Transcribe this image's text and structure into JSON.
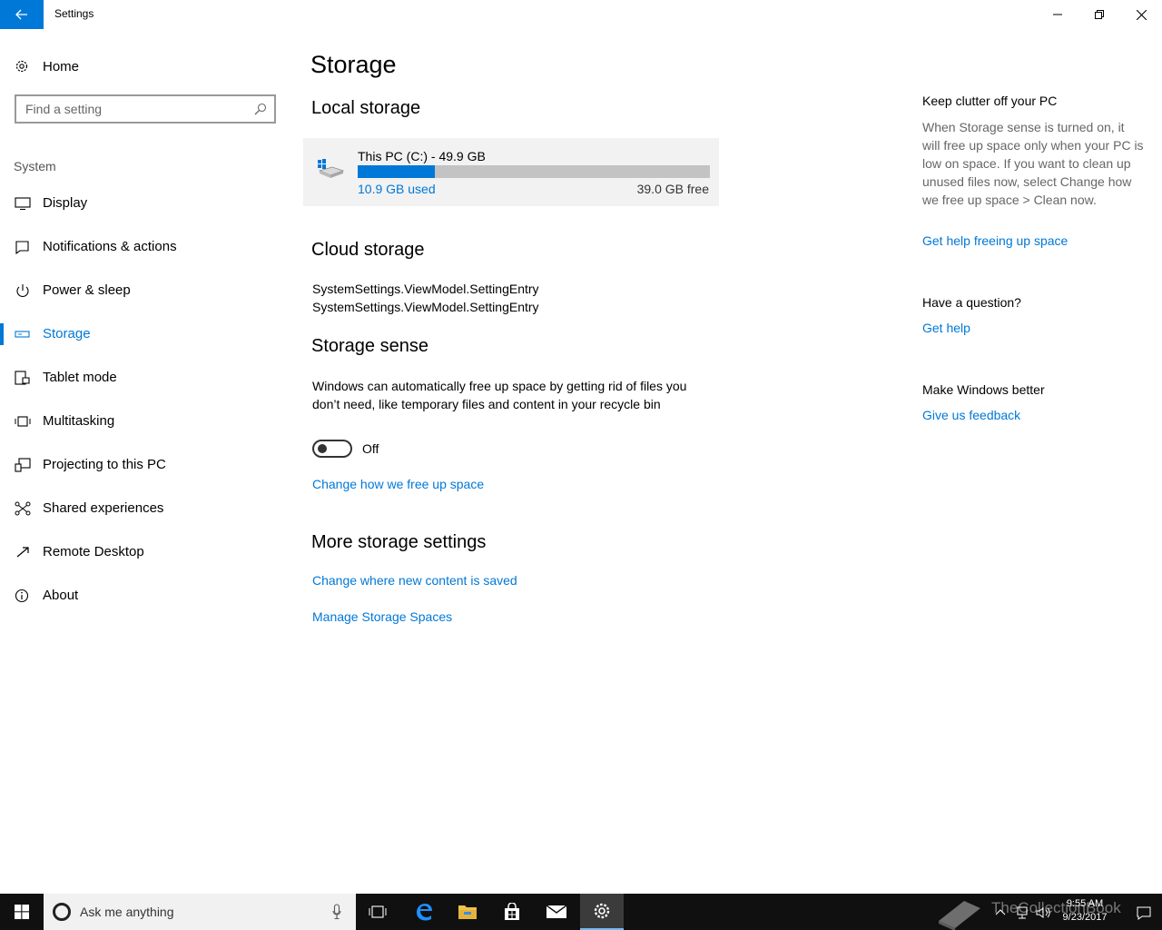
{
  "window": {
    "title": "Settings"
  },
  "sidebar": {
    "home": "Home",
    "search_placeholder": "Find a setting",
    "section": "System",
    "items": [
      {
        "label": "Display",
        "icon": "monitor-icon"
      },
      {
        "label": "Notifications & actions",
        "icon": "message-icon"
      },
      {
        "label": "Power & sleep",
        "icon": "power-icon"
      },
      {
        "label": "Storage",
        "icon": "storage-icon",
        "selected": true
      },
      {
        "label": "Tablet mode",
        "icon": "tablet-icon"
      },
      {
        "label": "Multitasking",
        "icon": "multitasking-icon"
      },
      {
        "label": "Projecting to this PC",
        "icon": "projecting-icon"
      },
      {
        "label": "Shared experiences",
        "icon": "shared-icon"
      },
      {
        "label": "Remote Desktop",
        "icon": "remote-desktop-icon"
      },
      {
        "label": "About",
        "icon": "info-icon"
      }
    ]
  },
  "main": {
    "title": "Storage",
    "local_heading": "Local storage",
    "drive": {
      "name": "This PC (C:) - 49.9 GB",
      "used": "10.9 GB used",
      "free": "39.0 GB free",
      "used_fraction": 0.218
    },
    "cloud_heading": "Cloud storage",
    "cloud_entries": [
      "SystemSettings.ViewModel.SettingEntry",
      "SystemSettings.ViewModel.SettingEntry"
    ],
    "sense_heading": "Storage sense",
    "sense_desc": "Windows can automatically free up space by getting rid of files you don’t need, like temporary files and content in your recycle bin",
    "sense_toggle": "Off",
    "sense_link": "Change how we free up space",
    "more_heading": "More storage settings",
    "more_links": [
      "Change where new content is saved",
      "Manage Storage Spaces"
    ]
  },
  "right": {
    "clutter_heading": "Keep clutter off your PC",
    "clutter_text": "When Storage sense is turned on, it will free up space only when your PC is low on space. If you want to clean up unused files now, select Change how we free up space > Clean now.",
    "clutter_link": "Get help freeing up space",
    "question_heading": "Have a question?",
    "question_link": "Get help",
    "better_heading": "Make Windows better",
    "better_link": "Give us feedback"
  },
  "taskbar": {
    "search_placeholder": "Ask me anything",
    "time": "9:55 AM",
    "date": "9/23/2017",
    "watermark": "TheCollectionBook"
  },
  "colors": {
    "accent": "#0078d7",
    "taskbar": "#101010"
  }
}
